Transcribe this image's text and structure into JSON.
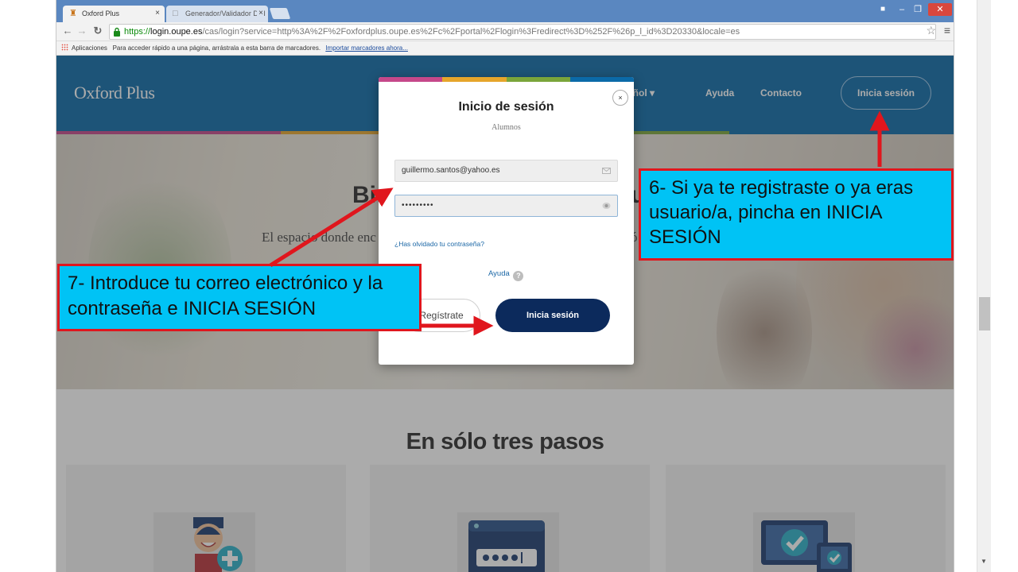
{
  "browser": {
    "tabs": [
      {
        "title": "Oxford Plus",
        "active": true
      },
      {
        "title": "Generador/Validador DNI",
        "active": false
      }
    ],
    "tab_close_glyph": "×",
    "url": {
      "scheme": "https://",
      "host": "login.oupe.es",
      "rest": "/cas/login?service=http%3A%2F%2Foxfordplus.oupe.es%2Fc%2Fportal%2Flogin%3Fredirect%3D%252F%26p_l_id%3D20330&locale=es"
    },
    "bookmarks": {
      "apps": "Aplicaciones",
      "hint": "Para acceder rápido a una página, arrástrala a esta barra de marcadores.",
      "import": "Importar marcadores ahora..."
    }
  },
  "site": {
    "logo": "Oxford Plus",
    "nav": {
      "language": "añol  ▾",
      "help": "Ayuda",
      "contact": "Contacto",
      "login": "Inicia sesión"
    },
    "hero": {
      "title_start": "Bi",
      "title_end": "u",
      "subtitle_start": "El espacio donde enc",
      "subtitle_end": "ó"
    },
    "steps_title": "En sólo tres pasos",
    "stripe_colors": [
      "#c5488a",
      "#e6a52b",
      "#7aa53a",
      "#0b6aa8"
    ]
  },
  "modal": {
    "close": "×",
    "title": "Inicio de sesión",
    "subtitle": "Alumnos",
    "email_value": "guillermo.santos@yahoo.es",
    "password_value": "•••••••••",
    "forgot": "¿Has olvidado tu contraseña?",
    "help": "Ayuda",
    "help_icon": "?",
    "register": "Regístrate",
    "login": "Inicia sesión"
  },
  "callouts": {
    "step6": "6- Si ya te registraste o ya eras usuario/a, pincha en INICIA SESIÓN",
    "step7": "7- Introduce tu correo electrónico y la contraseña e INICIA SESIÓN"
  },
  "colors": {
    "header": "#0b6aa8",
    "primary_button": "#0c2a5c",
    "callout_fill": "#00c3f5",
    "callout_border": "#e0161d"
  },
  "icons": {
    "back": "back-arrow-icon",
    "forward": "forward-arrow-icon",
    "reload": "reload-icon",
    "lock": "lock-icon",
    "star": "bookmark-star-icon",
    "menu": "menu-icon",
    "email": "envelope-icon",
    "password": "eye-icon"
  }
}
